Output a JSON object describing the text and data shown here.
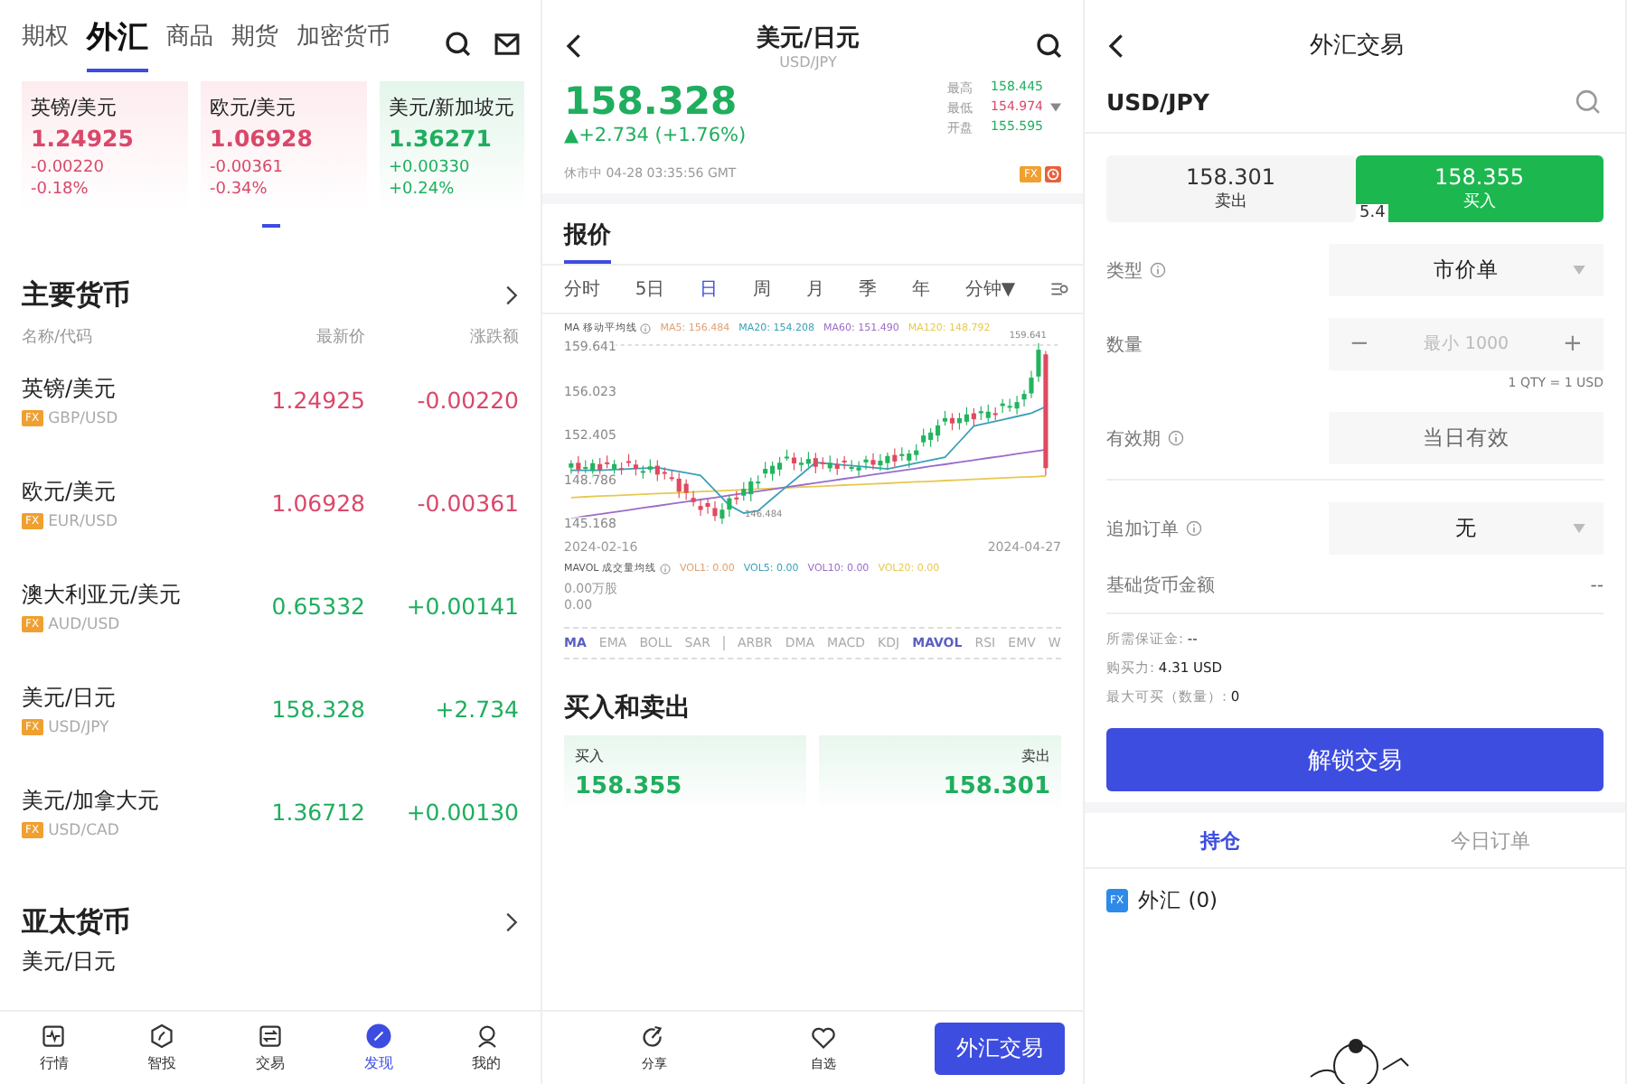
{
  "market_screen": {
    "tabs": [
      {
        "label": "期权",
        "selected": false
      },
      {
        "label": "外汇",
        "selected": true
      },
      {
        "label": "商品",
        "selected": false
      },
      {
        "label": "期货",
        "selected": false
      },
      {
        "label": "加密货币",
        "selected": false
      }
    ],
    "cards": [
      {
        "name": "英镑/美元",
        "price": "1.24925",
        "change": "-0.00220",
        "percent": "-0.18%",
        "rising": false
      },
      {
        "name": "欧元/美元",
        "price": "1.06928",
        "change": "-0.00361",
        "percent": "-0.34%",
        "rising": false
      },
      {
        "name": "美元/新加坡元",
        "price": "1.36271",
        "change": "+0.00330",
        "percent": "+0.24%",
        "rising": true
      }
    ],
    "sections": [
      {
        "title": "主要货币",
        "columns": [
          "名称/代码",
          "最新价",
          "涨跌额"
        ],
        "rows": [
          {
            "name": "英镑/美元",
            "badge": "FX",
            "code": "GBP/USD",
            "price": "1.24925",
            "change": "-0.00220",
            "rising": false
          },
          {
            "name": "欧元/美元",
            "badge": "FX",
            "code": "EUR/USD",
            "price": "1.06928",
            "change": "-0.00361",
            "rising": false
          },
          {
            "name": "澳大利亚元/美元",
            "badge": "FX",
            "code": "AUD/USD",
            "price": "0.65332",
            "change": "+0.00141",
            "rising": true
          },
          {
            "name": "美元/日元",
            "badge": "FX",
            "code": "USD/JPY",
            "price": "158.328",
            "change": "+2.734",
            "rising": true
          },
          {
            "name": "美元/加拿大元",
            "badge": "FX",
            "code": "USD/CAD",
            "price": "1.36712",
            "change": "+0.00130",
            "rising": true
          }
        ]
      },
      {
        "title": "亚太货币",
        "rows": [
          {
            "name": "美元/日元"
          }
        ]
      }
    ],
    "nav": [
      {
        "label": "行情",
        "selected": false
      },
      {
        "label": "智投",
        "selected": false
      },
      {
        "label": "交易",
        "selected": false
      },
      {
        "label": "发现",
        "selected": true
      },
      {
        "label": "我的",
        "selected": false
      }
    ]
  },
  "detail_screen": {
    "title": "美元/日元",
    "subtitle": "USD/JPY",
    "price": "158.328",
    "change": "▲+2.734 (+1.76%)",
    "rising": true,
    "stats": [
      {
        "label": "最高",
        "value": "158.445",
        "rising": true
      },
      {
        "label": "最低",
        "value": "154.974",
        "rising": false
      },
      {
        "label": "开盘",
        "value": "155.595",
        "rising": true
      }
    ],
    "status": "休市中 04-28 03:35:56 GMT",
    "badge": "FX",
    "section_tab": "报价",
    "periods": [
      {
        "label": "分时",
        "selected": false
      },
      {
        "label": "5日",
        "selected": false
      },
      {
        "label": "日",
        "selected": true
      },
      {
        "label": "周",
        "selected": false
      },
      {
        "label": "月",
        "selected": false
      },
      {
        "label": "季",
        "selected": false
      },
      {
        "label": "年",
        "selected": false
      },
      {
        "label": "分钟▼",
        "selected": false
      }
    ],
    "ma_title": "MA 移动平均线",
    "ma_legend": [
      {
        "label": "MA5: 156.484",
        "color": "#e0a070"
      },
      {
        "label": "MA20: 154.208",
        "color": "#3aa0b8"
      },
      {
        "label": "MA60: 151.490",
        "color": "#9a6cc8"
      },
      {
        "label": "MA120: 148.792",
        "color": "#e8c850"
      }
    ],
    "price_ticks": [
      "159.641",
      "156.023",
      "152.405",
      "148.786",
      "145.168"
    ],
    "high_mark": "159.641",
    "low_mark": "146.484",
    "dates": [
      "2024-02-16",
      "2024-04-27"
    ],
    "vol_title": "MAVOL 成交量均线",
    "vol_legend": [
      {
        "label": "VOL1: 0.00",
        "color": "#e0a070"
      },
      {
        "label": "VOL5: 0.00",
        "color": "#3aa0b8"
      },
      {
        "label": "VOL10: 0.00",
        "color": "#9a6cc8"
      },
      {
        "label": "VOL20: 0.00",
        "color": "#e8c850"
      }
    ],
    "vol_values": [
      "0.00万股",
      "0.00"
    ],
    "main_indicators": [
      {
        "label": "MA",
        "selected": true
      },
      {
        "label": "EMA",
        "selected": false
      },
      {
        "label": "BOLL",
        "selected": false
      },
      {
        "label": "SAR",
        "selected": false
      }
    ],
    "sub_indicators": [
      {
        "label": "ARBR",
        "selected": false
      },
      {
        "label": "DMA",
        "selected": false
      },
      {
        "label": "MACD",
        "selected": false
      },
      {
        "label": "KDJ",
        "selected": false
      },
      {
        "label": "MAVOL",
        "selected": true
      },
      {
        "label": "RSI",
        "selected": false
      },
      {
        "label": "EMV",
        "selected": false
      },
      {
        "label": "W",
        "selected": false
      }
    ],
    "trade_heading": "买入和卖出",
    "quotes": [
      {
        "label": "买入",
        "price": "158.355"
      },
      {
        "label": "卖出",
        "price": "158.301"
      }
    ],
    "actions": [
      {
        "label": "分享"
      },
      {
        "label": "自选"
      }
    ],
    "trade_button": "外汇交易"
  },
  "trade_screen": {
    "title": "外汇交易",
    "symbol": "USD/JPY",
    "quotes": [
      {
        "price": "158.301",
        "label": "卖出",
        "selected": false
      },
      {
        "price": "158.355",
        "label": "买入",
        "selected": true
      }
    ],
    "spread": "5.4",
    "fields": [
      {
        "kind": "select",
        "label": "类型",
        "info": true,
        "value": "市价单"
      },
      {
        "kind": "stepper",
        "label": "数量",
        "info": false,
        "placeholder": "最小 1000",
        "minus": "−",
        "plus": "+",
        "note": "1 QTY = 1 USD"
      },
      {
        "kind": "box",
        "label": "有效期",
        "info": true,
        "value": "当日有效"
      },
      {
        "kind": "select",
        "label": "追加订单",
        "info": true,
        "value": "无"
      },
      {
        "kind": "plain",
        "label": "基础货币金额",
        "info": false,
        "value": "--"
      }
    ],
    "info": [
      {
        "label": "所需保证金: ",
        "value": "--"
      },
      {
        "label": "购买力: ",
        "value": "4.31 USD"
      },
      {
        "label": "最大可买（数量）: ",
        "value": "0"
      }
    ],
    "unlock_button": "解锁交易",
    "tabs": [
      {
        "label": "持仓",
        "selected": true
      },
      {
        "label": "今日订单",
        "selected": false
      }
    ],
    "badge": "FX",
    "holdings": "外汇 (0)"
  }
}
